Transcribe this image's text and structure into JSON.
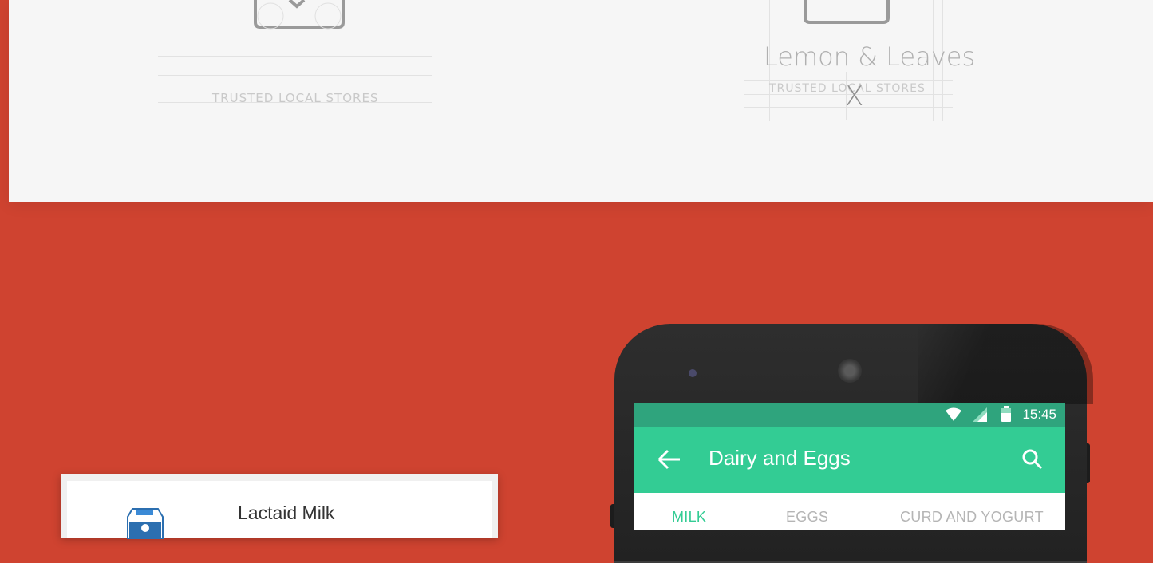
{
  "top_section": {
    "left_item": {
      "caption": "TRUSTED LOCAL STORES",
      "icon": "basket-icon"
    },
    "right_item": {
      "title": "Lemon & Leaves",
      "caption": "TRUSTED LOCAL STORES",
      "close_glyph": "X",
      "icon": "basket-icon"
    }
  },
  "product_card": {
    "name": "Lactaid Milk",
    "thumb_icon": "milk-carton-icon"
  },
  "phone": {
    "status_bar": {
      "time": "15:45",
      "icons": [
        "wifi-icon",
        "signal-icon",
        "battery-icon"
      ]
    },
    "app_bar": {
      "title": "Dairy and Eggs",
      "back_icon": "back-arrow-icon",
      "search_icon": "search-icon"
    },
    "tabs": [
      {
        "label": "MILK",
        "active": true
      },
      {
        "label": "EGGS",
        "active": false
      },
      {
        "label": "CURD AND YOGURT",
        "active": false
      }
    ]
  },
  "colors": {
    "background": "#cf4330",
    "panel": "#f6f6f6",
    "accent": "#33cc94",
    "status_bar": "#2fa47d"
  }
}
